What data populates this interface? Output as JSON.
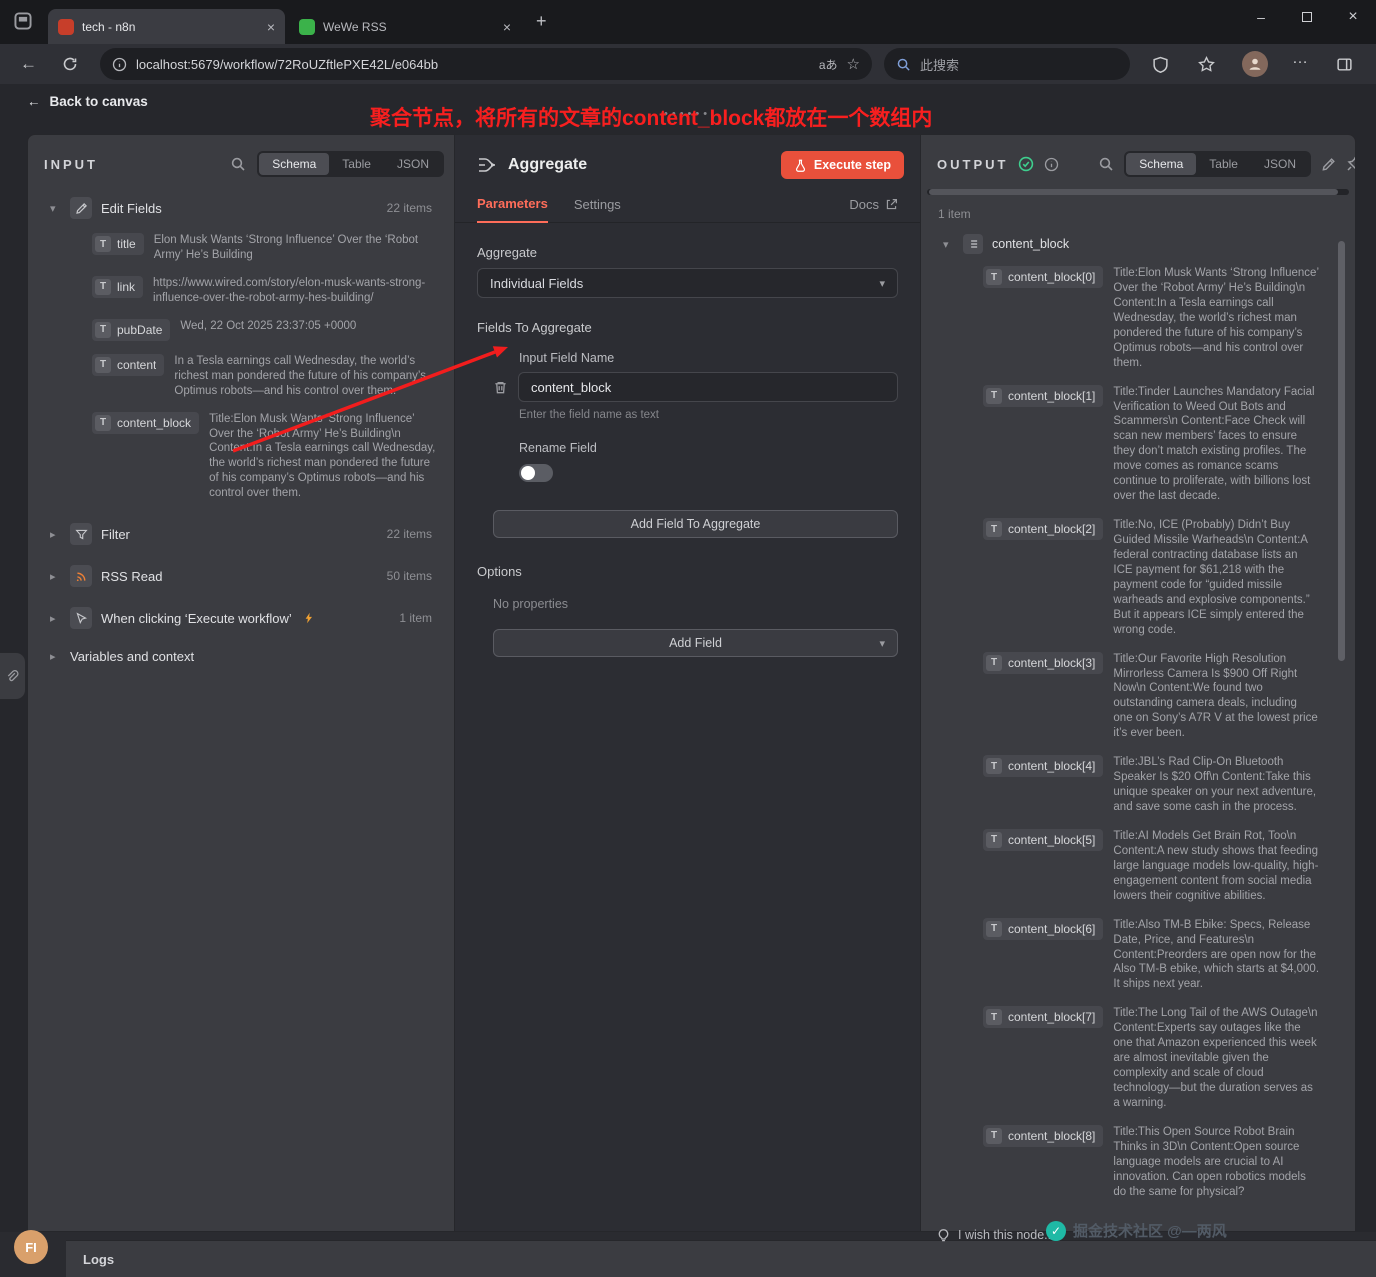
{
  "browser": {
    "tabs": [
      {
        "title": "tech - n8n"
      },
      {
        "title": "WeWe RSS"
      }
    ],
    "url": "localhost:5679/workflow/72RoUZftlePXE42L/e064bb",
    "search_placeholder": "此搜索",
    "translate_label": "aあ",
    "new_tab": "+",
    "close_glyph": "×",
    "minimize_glyph": "–",
    "more_glyph": "…"
  },
  "canvas": {
    "back_link": "Back to canvas",
    "annotation": "聚合节点，将所有的文章的content_block都放在一个数组内",
    "drag_handle": "••••••"
  },
  "input_panel": {
    "title": "INPUT",
    "tabs": {
      "schema": "Schema",
      "table": "Table",
      "json": "JSON"
    },
    "edit_fields": {
      "name": "Edit Fields",
      "count": "22 items"
    },
    "fields": [
      {
        "type": "T",
        "key": "title",
        "value": "Elon Musk Wants ‘Strong Influence’ Over the ‘Robot Army’ He’s Building"
      },
      {
        "type": "T",
        "key": "link",
        "value": "https://www.wired.com/story/elon-musk-wants-strong-influence-over-the-robot-army-hes-building/"
      },
      {
        "type": "T",
        "key": "pubDate",
        "value": "Wed, 22 Oct 2025 23:37:05 +0000"
      },
      {
        "type": "T",
        "key": "content",
        "value": "In a Tesla earnings call Wednesday, the world’s richest man pondered the future of his company’s Optimus robots—and his control over them."
      },
      {
        "type": "T",
        "key": "content_block",
        "value": "Title:Elon Musk Wants ‘Strong Influence’ Over the ‘Robot Army’ He’s Building\\n Content:In a Tesla earnings call Wednesday, the world’s richest man pondered the future of his company’s Optimus robots—and his control over them."
      }
    ],
    "nodes": [
      {
        "name": "Filter",
        "count": "22 items",
        "icon": "filter-icon",
        "bolt": false
      },
      {
        "name": "RSS Read",
        "count": "50 items",
        "icon": "rss-icon",
        "bolt": false
      },
      {
        "name": "When clicking ‘Execute workflow’",
        "count": "1 item",
        "icon": "trigger-icon",
        "bolt": true
      },
      {
        "name": "Variables and context",
        "count": "",
        "icon": "",
        "bolt": false
      }
    ]
  },
  "node_editor": {
    "title": "Aggregate",
    "execute_button": "Execute step",
    "tabs": {
      "parameters": "Parameters",
      "settings": "Settings",
      "docs": "Docs"
    },
    "aggregate_label": "Aggregate",
    "aggregate_value": "Individual Fields",
    "fields_section": "Fields To Aggregate",
    "input_field_label": "Input Field Name",
    "input_field_value": "content_block",
    "input_field_help": "Enter the field name as text",
    "rename_label": "Rename Field",
    "add_field_button": "Add Field To Aggregate",
    "options_section": "Options",
    "no_properties": "No properties",
    "add_option_button": "Add Field"
  },
  "output_panel": {
    "title": "OUTPUT",
    "count": "1 item",
    "tabs": {
      "schema": "Schema",
      "table": "Table",
      "json": "JSON"
    },
    "root_key": "content_block",
    "items": [
      {
        "type": "T",
        "key": "content_block[0]",
        "value": "Title:Elon Musk Wants ‘Strong Influence’ Over the ‘Robot Army’ He’s Building\\n Content:In a Tesla earnings call Wednesday, the world’s richest man pondered the future of his company’s Optimus robots—and his control over them."
      },
      {
        "type": "T",
        "key": "content_block[1]",
        "value": "Title:Tinder Launches Mandatory Facial Verification to Weed Out Bots and Scammers\\n Content:Face Check will scan new members’ faces to ensure they don’t match existing profiles. The move comes as romance scams continue to proliferate, with billions lost over the last decade."
      },
      {
        "type": "T",
        "key": "content_block[2]",
        "value": "Title:No, ICE (Probably) Didn’t Buy Guided Missile Warheads\\n Content:A federal contracting database lists an ICE payment for $61,218 with the payment code for “guided missile warheads and explosive components.” But it appears ICE simply entered the wrong code."
      },
      {
        "type": "T",
        "key": "content_block[3]",
        "value": "Title:Our Favorite High Resolution Mirrorless Camera Is $900 Off Right Now\\n Content:We found two outstanding camera deals, including one on Sony’s A7R V at the lowest price it’s ever been."
      },
      {
        "type": "T",
        "key": "content_block[4]",
        "value": "Title:JBL’s Rad Clip-On Bluetooth Speaker Is $20 Off\\n Content:Take this unique speaker on your next adventure, and save some cash in the process."
      },
      {
        "type": "T",
        "key": "content_block[5]",
        "value": "Title:AI Models Get Brain Rot, Too\\n Content:A new study shows that feeding large language models low-quality, high-engagement content from social media lowers their cognitive abilities."
      },
      {
        "type": "T",
        "key": "content_block[6]",
        "value": "Title:Also TM-B Ebike: Specs, Release Date, Price, and Features\\n Content:Preorders are open now for the Also TM-B ebike, which starts at $4,000. It ships next year."
      },
      {
        "type": "T",
        "key": "content_block[7]",
        "value": "Title:The Long Tail of the AWS Outage\\n Content:Experts say outages like the one that Amazon experienced this week are almost inevitable given the complexity and scale of cloud technology—but the duration serves as a warning."
      },
      {
        "type": "T",
        "key": "content_block[8]",
        "value": "Title:This Open Source Robot Brain Thinks in 3D\\n Content:Open source language models are crucial to AI innovation. Can open robotics models do the same for physical?"
      }
    ]
  },
  "footer": {
    "logs_label": "Logs",
    "feedback": "I wish this node...",
    "watermark": "掘金技术社区 @—两风",
    "avatar_initials": "FI"
  },
  "colors": {
    "accent": "#ff6d5a",
    "execute_button": "#e9503b",
    "annotation_red": "#f81f1f",
    "success_green": "#3ecf8e",
    "rss_orange": "#ee8035"
  }
}
